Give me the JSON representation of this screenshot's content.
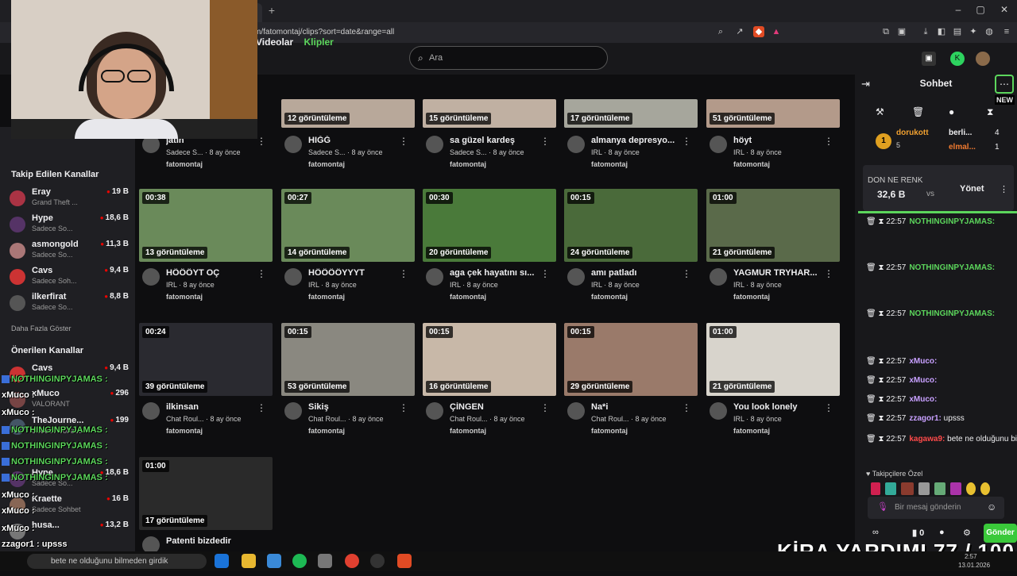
{
  "browser": {
    "url": "m/fatomontaj/clips?sort=date&range=all",
    "new_tab_label": "+"
  },
  "top": {
    "search_placeholder": "Ara",
    "tabs": [
      "Videolar",
      "Klipler"
    ]
  },
  "sidebar": {
    "followed_heading": "Takip Edilen Kanallar",
    "followed": [
      {
        "name": "Eray",
        "game": "Grand Theft ...",
        "viewers": "19 B"
      },
      {
        "name": "Hype",
        "game": "Sadece So...",
        "viewers": "18,6 B"
      },
      {
        "name": "asmongold",
        "game": "Sadece So...",
        "viewers": "11,3 B"
      },
      {
        "name": "Cavs",
        "game": "Sadece Soh...",
        "viewers": "9,4 B"
      },
      {
        "name": "ilkerfirat",
        "game": "Sadece So...",
        "viewers": "8,8 B"
      }
    ],
    "more_label": "Daha Fazla Göster",
    "recommended_heading": "Önerilen Kanallar",
    "recommended": [
      {
        "name": "Cavs",
        "game": "",
        "viewers": "9,4 B"
      },
      {
        "name": "xMuco",
        "game": "VALORANT",
        "viewers": "296"
      },
      {
        "name": "TheJourne...",
        "game": "Sadece Sohbet",
        "viewers": "199"
      },
      {
        "name": "Hype",
        "game": "Sadece So...",
        "viewers": "18,6 B"
      },
      {
        "name": "Kraette",
        "game": "Sadece Sohbet",
        "viewers": "16 B"
      },
      {
        "name": "husa...",
        "game": "",
        "viewers": "13,2 B"
      }
    ],
    "overlay_chat": [
      "NOTHINGINPYJAMAS :",
      "xMuco :",
      "xMuco :",
      "NOTHINGINPYJAMAS :",
      "NOTHINGINPYJAMAS :",
      "NOTHINGINPYJAMAS :",
      "NOTHINGINPYJAMAS :",
      "xMuco :",
      "xMuco :",
      "xMuco :",
      "zzagor1 : upsss",
      "kagawa9 : bete ne olduğunu bilmeden girdik"
    ]
  },
  "clips_top_row": [
    {
      "views": "12 görüntüleme",
      "title": "HIĞĞ",
      "game": "Sadece S...",
      "ago": "8 ay önce",
      "channel": "fatomontaj"
    },
    {
      "views": "15 görüntüleme",
      "title": "sa güzel kardeş",
      "game": "Sadece S...",
      "ago": "8 ay önce",
      "channel": "fatomontaj"
    },
    {
      "views": "17 görüntüleme",
      "title": "almanya depresyo...",
      "game": "IRL",
      "ago": "8 ay önce",
      "channel": "fatomontaj"
    },
    {
      "views": "51 görüntüleme",
      "title": "höyt",
      "game": "IRL",
      "ago": "8 ay önce",
      "channel": "fatomontaj"
    }
  ],
  "partial_first": {
    "title": "jatin",
    "game": "Sadece S...",
    "ago": "8 ay önce",
    "channel": "fatomontaj"
  },
  "clips": [
    {
      "duration": "00:38",
      "views": "13 görüntüleme",
      "title": "HÖÖÖYT OÇ",
      "game": "IRL",
      "ago": "8 ay önce",
      "channel": "fatomontaj"
    },
    {
      "duration": "00:27",
      "views": "14 görüntüleme",
      "title": "HÖÖÖÖYYYT",
      "game": "IRL",
      "ago": "8 ay önce",
      "channel": "fatomontaj"
    },
    {
      "duration": "00:30",
      "views": "20 görüntüleme",
      "title": "aga çek hayatını sı...",
      "game": "IRL",
      "ago": "8 ay önce",
      "channel": "fatomontaj"
    },
    {
      "duration": "00:15",
      "views": "24 görüntüleme",
      "title": "amı patladı",
      "game": "IRL",
      "ago": "8 ay önce",
      "channel": "fatomontaj"
    },
    {
      "duration": "01:00",
      "views": "21 görüntüleme",
      "title": "YAGMUR TRYHAR...",
      "game": "IRL",
      "ago": "8 ay önce",
      "channel": "fatomontaj"
    },
    {
      "duration": "00:24",
      "views": "39 görüntüleme",
      "title": "ilkinsan",
      "game": "Chat Roul...",
      "ago": "8 ay önce",
      "channel": "fatomontaj"
    },
    {
      "duration": "00:15",
      "views": "53 görüntüleme",
      "title": "Sikiş",
      "game": "Chat Roul...",
      "ago": "8 ay önce",
      "channel": "fatomontaj"
    },
    {
      "duration": "00:15",
      "views": "16 görüntüleme",
      "title": "ÇİNGEN",
      "game": "Chat Roul...",
      "ago": "8 ay önce",
      "channel": "fatomontaj"
    },
    {
      "duration": "00:15",
      "views": "29 görüntüleme",
      "title": "Na*i",
      "game": "Chat Roul...",
      "ago": "8 ay önce",
      "channel": "fatomontaj"
    },
    {
      "duration": "01:00",
      "views": "21 görüntüleme",
      "title": "You look lonely",
      "game": "IRL",
      "ago": "8 ay önce",
      "channel": "fatomontaj"
    },
    {
      "duration": "01:00",
      "views": "17 görüntüleme",
      "title": "Patenti bizdedir",
      "game": "",
      "ago": "",
      "channel": ""
    }
  ],
  "chat": {
    "title": "Sohbet",
    "new_badge": "NEW",
    "leaders": [
      {
        "rank": "1",
        "name": "dorukott",
        "count": "5"
      },
      {
        "name": "berli...",
        "count": "4"
      },
      {
        "name": "elmal...",
        "count": "1"
      }
    ],
    "poll": {
      "title": "DON NE RENK",
      "amount": "32,6 B",
      "vs": "vs",
      "manage": "Yönet"
    },
    "messages": [
      {
        "time": "22:57",
        "user": "NOTHINGINPYJAMAS:",
        "text": "",
        "color": "#5cd65c"
      },
      {
        "time": "22:57",
        "user": "NOTHINGINPYJAMAS:",
        "text": "",
        "color": "#5cd65c"
      },
      {
        "time": "22:57",
        "user": "NOTHINGINPYJAMAS:",
        "text": "",
        "color": "#5cd65c"
      },
      {
        "time": "22:57",
        "user": "xMuco:",
        "text": "",
        "color": "#c8a0ff"
      },
      {
        "time": "22:57",
        "user": "xMuco:",
        "text": "",
        "color": "#c8a0ff"
      },
      {
        "time": "22:57",
        "user": "xMuco:",
        "text": "",
        "color": "#c8a0ff"
      },
      {
        "time": "22:57",
        "user": "zzagor1:",
        "text": "upsss",
        "color": "#c8a0ff"
      },
      {
        "time": "22:57",
        "user": "kagawa9:",
        "text": "bete ne olduğunu bilmeden girdik",
        "color": "#ff4a4a"
      }
    ],
    "followers_only": "Takipçilere Özel",
    "input_placeholder": "Bir mesaj gönderin",
    "points": "0",
    "send_label": "Gönder"
  },
  "overlay_text": "KİRA YARDIMI 77 / 100",
  "taskbar": {
    "search_text": "bete ne olduğunu bilmeden girdik",
    "clock": "2:57",
    "date": "13.01.2026"
  },
  "colors": {
    "accent": "#5cd65c",
    "bg": "#0e0e10",
    "live": "#eb0400"
  }
}
